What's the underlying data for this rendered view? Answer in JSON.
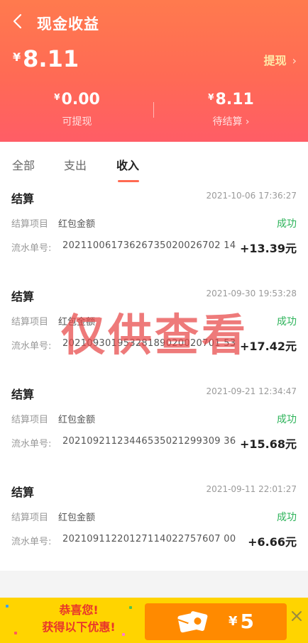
{
  "header": {
    "title": "现金收益",
    "currency_symbol": "¥",
    "total": "8.11",
    "withdraw_label": "提现",
    "available_amount": "0.00",
    "available_label": "可提现",
    "pending_amount": "8.11",
    "pending_label": "待结算"
  },
  "tabs": [
    {
      "label": "全部",
      "active": false
    },
    {
      "label": "支出",
      "active": false
    },
    {
      "label": "收入",
      "active": true
    }
  ],
  "records": [
    {
      "title": "结算",
      "time": "2021-10-06 17:36:27",
      "project_label": "结算项目",
      "project": "红包金额",
      "status": "成功",
      "serial_label": "流水单号:",
      "serial": "20211006173626735020026702 14",
      "amount": "+13.39元"
    },
    {
      "title": "结算",
      "time": "2021-09-30 19:53:28",
      "project_label": "结算项目",
      "project": "红包金额",
      "status": "成功",
      "serial_label": "流水单号:",
      "serial": "20210930195328189020020701 53",
      "amount": "+17.42元"
    },
    {
      "title": "结算",
      "time": "2021-09-21 12:34:47",
      "project_label": "结算项目",
      "project": "红包金额",
      "status": "成功",
      "serial_label": "流水单号:",
      "serial": "20210921123446535021299309 36",
      "amount": "+15.68元"
    },
    {
      "title": "结算",
      "time": "2021-09-11 22:01:27",
      "project_label": "结算项目",
      "project": "红包金额",
      "status": "成功",
      "serial_label": "流水单号:",
      "serial": "20210911220127114022757607 00",
      "amount": "+6.66元"
    }
  ],
  "watermark": "仅供查看",
  "promo": {
    "line1": "恭喜您!",
    "line2": "获得以下优惠!",
    "currency_symbol": "¥",
    "coupon_amount": "5"
  },
  "icons": {
    "back": "chevron-left-icon",
    "withdraw_arrow": "chevron-right-icon",
    "pending_arrow": "chevron-right-icon",
    "coupon": "red-envelope-icon",
    "close": "close-icon"
  },
  "colors": {
    "header_top": "#ff7a4e",
    "header_bottom": "#ff5d66",
    "status_success": "#2db35a",
    "promo_bg": "#ffd400",
    "coupon_bg": "#ff8a00",
    "watermark": "#e84646"
  }
}
